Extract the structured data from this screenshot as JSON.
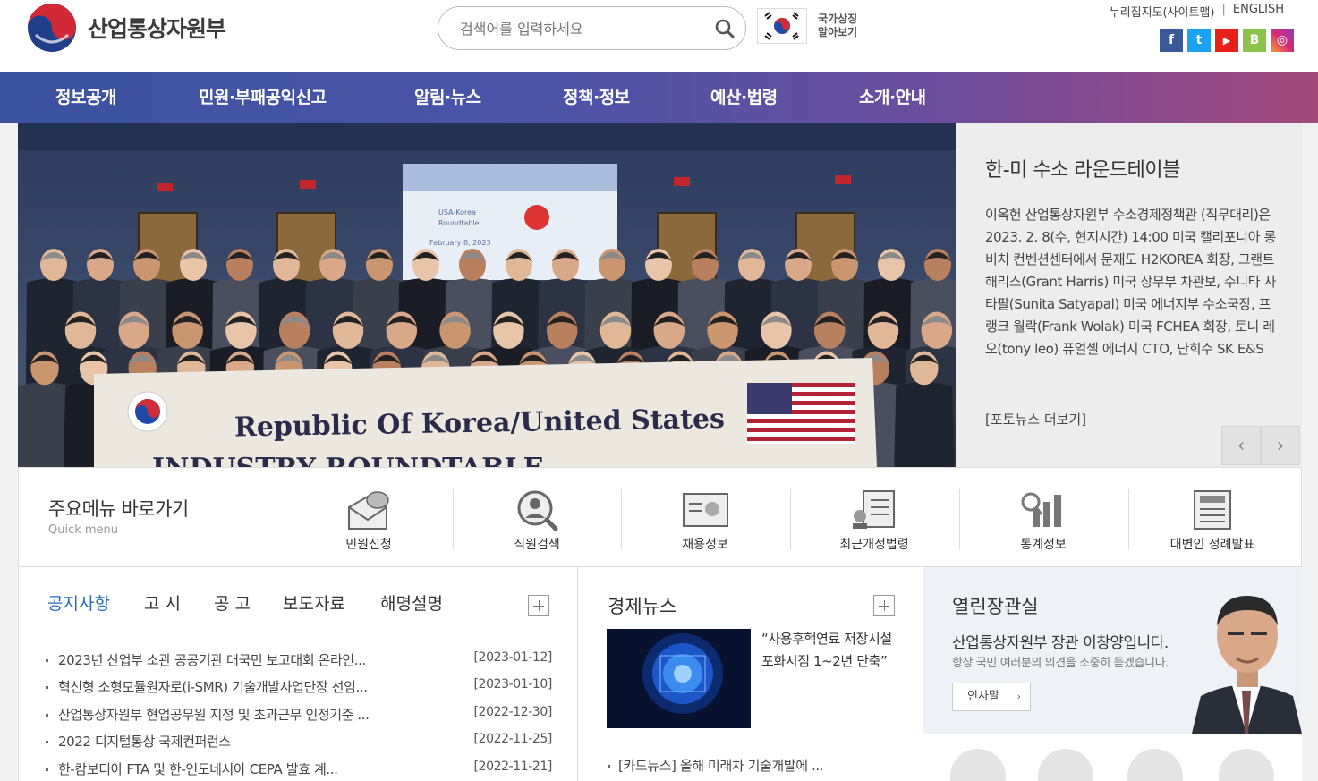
{
  "header": {
    "logo_text": "산업통상자원부",
    "search_placeholder": "검색어를 입력하세요",
    "national_symbol": "국가상징 알아보기",
    "top_links": [
      "누리집지도(사이트맵)",
      "ENGLISH"
    ],
    "sns": [
      {
        "name": "facebook-icon",
        "glyph": "f",
        "color": "#3b5998"
      },
      {
        "name": "twitter-icon",
        "glyph": "t",
        "color": "#1da1f2"
      },
      {
        "name": "youtube-icon",
        "glyph": "▶",
        "color": "#e62117"
      },
      {
        "name": "blog-icon",
        "glyph": "B",
        "color": "#8bc34a"
      },
      {
        "name": "instagram-icon",
        "glyph": "◎",
        "color": "#d62976"
      }
    ]
  },
  "gnb": [
    "정보공개",
    "민원·부패공익신고",
    "알림·뉴스",
    "정책·정보",
    "예산·법령",
    "소개·안내"
  ],
  "visual": {
    "banner_text": "Republic Of Korea/United States",
    "screen_lines": [
      "USA-Korea",
      "Roundtable",
      "February 8, 2023"
    ]
  },
  "news": {
    "title": "한-미 수소 라운드테이블",
    "body": "이옥헌 산업통상자원부 수소경제정책관 (직무대리)은 2023. 2. 8(수, 현지시간) 14:00 미국 캘리포니아 롱비치 컨벤션센터에서 문재도 H2KOREA 회장, 그랜트 해리스(Grant Harris) 미국 상무부 차관보, 수니타 사타팔(Sunita Satyapal) 미국 에너지부 수소국장, 프랭크 월락(Frank Wolak) 미국 FCHEA 회장, 토니 레오(tony leo) 퓨얼셀 에너지 CTO, 단희수 SK E&S",
    "more": "[포토뉴스 더보기]",
    "prev": "‹",
    "next": "›"
  },
  "quick": {
    "title": "주요메뉴 바로가기",
    "subtitle": "Quick menu",
    "items": [
      "민원신청",
      "직원검색",
      "채용정보",
      "최근개정법령",
      "통계정보",
      "대변인 정례발표"
    ]
  },
  "board": {
    "tabs": [
      "공지사항",
      "고 시",
      "공 고",
      "보도자료",
      "해명설명"
    ],
    "rows": [
      {
        "title": "2023년 산업부 소관 공공기관 대국민 보고대회 온라인...",
        "date": "[2023-01-12]"
      },
      {
        "title": "혁신형 소형모듈원자로(i-SMR) 기술개발사업단장 선임...",
        "date": "[2023-01-10]"
      },
      {
        "title": "산업통상자원부 현업공무원 지정 및 초과근무 인정기준 ...",
        "date": "[2022-12-30]"
      },
      {
        "title": "2022 디지털통상 국제컨퍼런스",
        "date": "[2022-11-25]"
      },
      {
        "title": "한-캄보디아 FTA 및 한-인도네시아 CEPA 발효 계...",
        "date": "[2022-11-21]"
      }
    ]
  },
  "econ": {
    "title": "경제뉴스",
    "headline": "“사용후핵연료 저장시설 포화시점 1~2년 단축”",
    "row": "[카드뉴스] 올해 미래차 기술개발에 ..."
  },
  "minister": {
    "title": "열린장관실",
    "name": "산업통상자원부 장관 이창양입니다.",
    "sub": "항상 국민 여러분의 의견을 소중히 듣겠습니다.",
    "button": "인사말"
  }
}
